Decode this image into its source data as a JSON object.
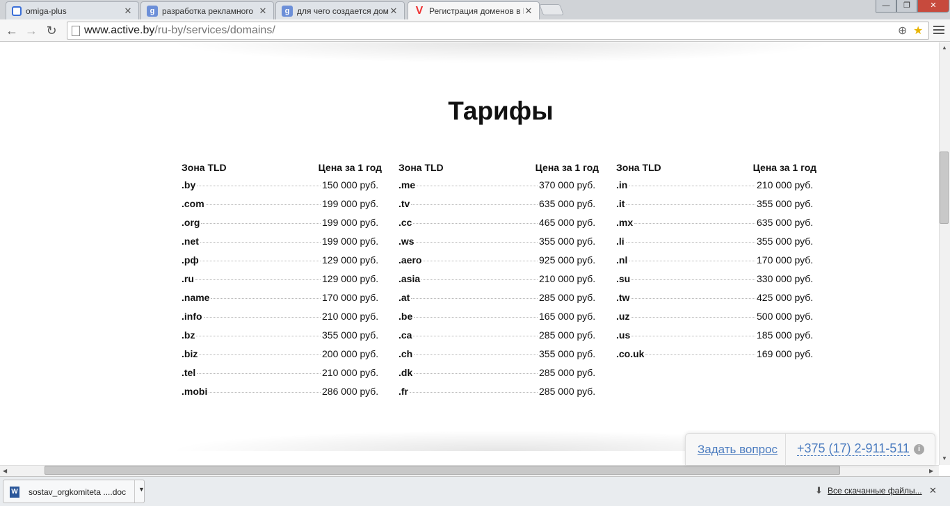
{
  "browser": {
    "tabs": [
      {
        "label": "omiga-plus",
        "favicon": "opera-icon"
      },
      {
        "label": "разработка рекламного",
        "favicon": "google-icon"
      },
      {
        "label": "для чего создается домен",
        "favicon": "google-icon"
      },
      {
        "label": "Регистрация доменов в Б",
        "favicon": "v-icon"
      }
    ],
    "url_host": "www.active.by",
    "url_path": "/ru-by/services/domains/"
  },
  "page": {
    "title": "Тарифы",
    "col_zone_header": "Зона TLD",
    "col_price_header": "Цена за 1 год"
  },
  "tariffs": {
    "columns": [
      [
        {
          "zone": ".by",
          "price": "150 000 руб."
        },
        {
          "zone": ".com",
          "price": "199 000 руб."
        },
        {
          "zone": ".org",
          "price": "199 000 руб."
        },
        {
          "zone": ".net",
          "price": "199 000 руб."
        },
        {
          "zone": ".рф",
          "price": "129 000 руб."
        },
        {
          "zone": ".ru",
          "price": "129 000 руб."
        },
        {
          "zone": ".name",
          "price": "170 000 руб."
        },
        {
          "zone": ".info",
          "price": "210 000 руб."
        },
        {
          "zone": ".bz",
          "price": "355 000 руб."
        },
        {
          "zone": ".biz",
          "price": "200 000 руб."
        },
        {
          "zone": ".tel",
          "price": "210 000 руб."
        },
        {
          "zone": ".mobi",
          "price": "286 000 руб."
        }
      ],
      [
        {
          "zone": ".me",
          "price": "370 000 руб."
        },
        {
          "zone": ".tv",
          "price": "635 000 руб."
        },
        {
          "zone": ".cc",
          "price": "465 000 руб."
        },
        {
          "zone": ".ws",
          "price": "355 000 руб."
        },
        {
          "zone": ".aero",
          "price": "925 000 руб."
        },
        {
          "zone": ".asia",
          "price": "210 000 руб."
        },
        {
          "zone": ".at",
          "price": "285 000 руб."
        },
        {
          "zone": ".be",
          "price": "165 000 руб."
        },
        {
          "zone": ".ca",
          "price": "285 000 руб."
        },
        {
          "zone": ".ch",
          "price": "355 000 руб."
        },
        {
          "zone": ".dk",
          "price": "285 000 руб."
        },
        {
          "zone": ".fr",
          "price": "285 000 руб."
        }
      ],
      [
        {
          "zone": ".in",
          "price": "210 000 руб."
        },
        {
          "zone": ".it",
          "price": "355 000 руб."
        },
        {
          "zone": ".mx",
          "price": "635 000 руб."
        },
        {
          "zone": ".li",
          "price": "355 000 руб."
        },
        {
          "zone": ".nl",
          "price": "170 000 руб."
        },
        {
          "zone": ".su",
          "price": "330 000 руб."
        },
        {
          "zone": ".tw",
          "price": "425 000 руб."
        },
        {
          "zone": ".uz",
          "price": "500 000 руб."
        },
        {
          "zone": ".us",
          "price": "185 000 руб."
        },
        {
          "zone": ".co.uk",
          "price": "169 000 руб."
        }
      ]
    ]
  },
  "contact": {
    "ask_label": "Задать вопрос",
    "phone": "+375 (17) 2-911-511"
  },
  "downloads": {
    "file_name": "sostav_orgkomiteta ....doc",
    "show_all": "Все скачанные файлы..."
  }
}
